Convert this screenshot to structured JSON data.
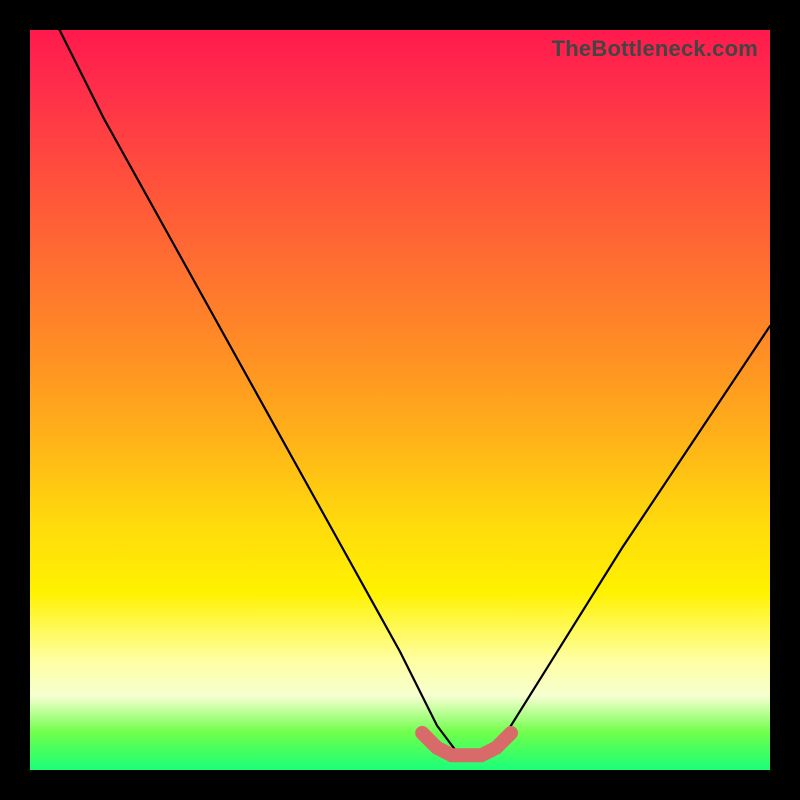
{
  "watermark": "TheBottleneck.com",
  "chart_data": {
    "type": "line",
    "title": "",
    "xlabel": "",
    "ylabel": "",
    "xlim": [
      0,
      100
    ],
    "ylim": [
      0,
      100
    ],
    "series": [
      {
        "name": "bottleneck-curve",
        "x": [
          4,
          10,
          20,
          30,
          40,
          50,
          55,
          58,
          62,
          65,
          70,
          80,
          90,
          100
        ],
        "values": [
          100,
          88,
          70,
          52,
          34,
          16,
          6,
          2,
          2,
          6,
          14,
          30,
          45,
          60
        ]
      }
    ],
    "highlight": {
      "name": "optimal-range",
      "x": [
        53,
        55,
        57,
        59,
        61,
        63,
        65
      ],
      "values": [
        5,
        3,
        2,
        2,
        2,
        3,
        5
      ],
      "color": "#d86a6a"
    },
    "colors": {
      "curve": "#000000",
      "highlight": "#d86a6a",
      "gradient_top": "#ff1a4d",
      "gradient_bottom": "#1aff7a",
      "frame": "#000000"
    }
  }
}
